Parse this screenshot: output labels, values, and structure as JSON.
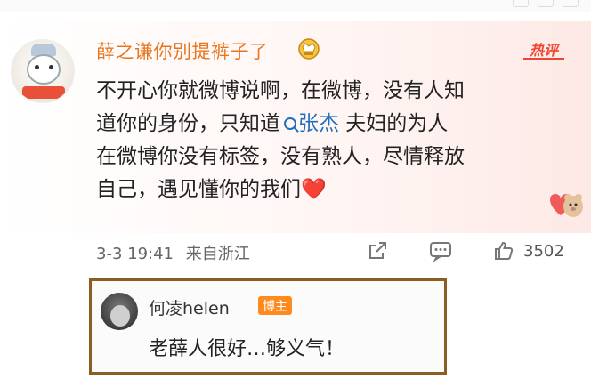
{
  "post": {
    "username": "薛之谦你别提裤子了",
    "hot_label": "热评",
    "content_lines": [
      "不开心你就微博说啊，在微博，没有人知",
      "道你的身份，只知道",
      "在微博你没有标签，没有熟人，尽情释放",
      "自己，遇见懂你的我们"
    ],
    "topic_link": "张杰",
    "content_after_topic": " 夫妇的为人",
    "heart_emoji": "❤️",
    "date": "3-3 19:41",
    "location": "来自浙江",
    "like_count": "3502"
  },
  "reply": {
    "name": "何凌helen",
    "tag": "博主",
    "text": "老薛人很好…够义气！"
  },
  "icons": {
    "badge": "crown-fan-badge-icon",
    "share": "share-icon",
    "comment": "comment-icon",
    "like": "thumbs-up-icon",
    "search": "search-icon",
    "sticker": "bear-heart-sticker-icon"
  },
  "colors": {
    "username": "#e8761f",
    "hot": "#ee4433",
    "topic": "#1f6fbf",
    "reply_border": "#8b5d22",
    "blogger_tag": "#ff8a1f"
  }
}
